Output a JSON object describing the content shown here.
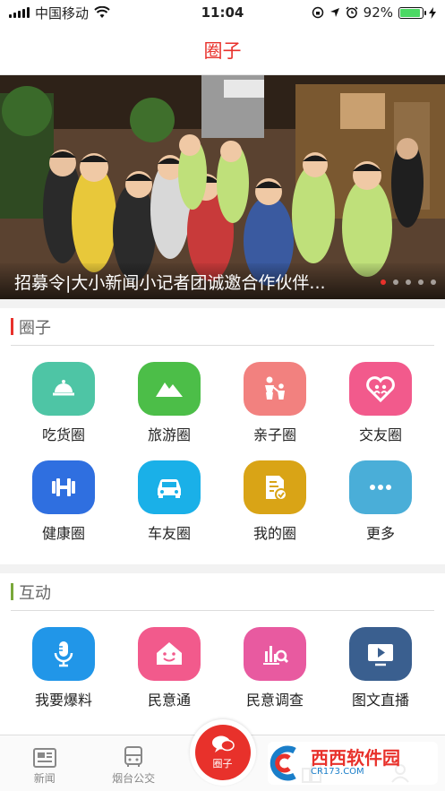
{
  "status_bar": {
    "carrier": "中国移动",
    "time": "11:04",
    "battery": "92%",
    "battery_level": 0.92,
    "icons": [
      "signal-icon",
      "wifi-icon",
      "orientation-lock-icon",
      "location-icon",
      "alarm-icon",
      "battery-icon",
      "charging-icon"
    ]
  },
  "nav": {
    "title": "圈子"
  },
  "banner": {
    "caption": "招募令|大小新闻小记者团诚邀合作伙伴...",
    "slide_count": 5,
    "active_slide": 1
  },
  "circle_section": {
    "title": "圈子",
    "accent": "#e8312b",
    "items": [
      {
        "label": "吃货圈",
        "icon": "food-cloche-icon",
        "color": "#4ec5a5"
      },
      {
        "label": "旅游圈",
        "icon": "mountain-icon",
        "color": "#4cbe48"
      },
      {
        "label": "亲子圈",
        "icon": "parent-child-icon",
        "color": "#f2817f"
      },
      {
        "label": "交友圈",
        "icon": "heart-people-icon",
        "color": "#f25a8c"
      },
      {
        "label": "健康圈",
        "icon": "dumbbell-icon",
        "color": "#2f6fe0"
      },
      {
        "label": "车友圈",
        "icon": "car-icon",
        "color": "#1ab0e8"
      },
      {
        "label": "我的圈",
        "icon": "document-check-icon",
        "color": "#d9a416"
      },
      {
        "label": "更多",
        "icon": "more-dots-icon",
        "color": "#4aaed8"
      }
    ]
  },
  "interact_section": {
    "title": "互动",
    "accent": "#7aa83a",
    "items": [
      {
        "label": "我要爆料",
        "icon": "microphone-icon",
        "color": "#2196e8"
      },
      {
        "label": "民意通",
        "icon": "smile-house-icon",
        "color": "#f25a8c"
      },
      {
        "label": "民意调查",
        "icon": "chart-search-icon",
        "color": "#e85aa0"
      },
      {
        "label": "图文直播",
        "icon": "video-play-icon",
        "color": "#3a5f8f"
      }
    ]
  },
  "tab_bar": {
    "tabs": [
      {
        "label": "新闻",
        "icon": "news-icon"
      },
      {
        "label": "烟台公交",
        "icon": "bus-icon"
      },
      {
        "label": "圈子",
        "icon": "chat-bubble-icon"
      },
      {
        "label": "",
        "icon": "city-icon"
      },
      {
        "label": "",
        "icon": "profile-icon"
      }
    ],
    "active_index": 2
  },
  "watermark": {
    "main": "西西软件园",
    "sub": "CR173.COM"
  }
}
